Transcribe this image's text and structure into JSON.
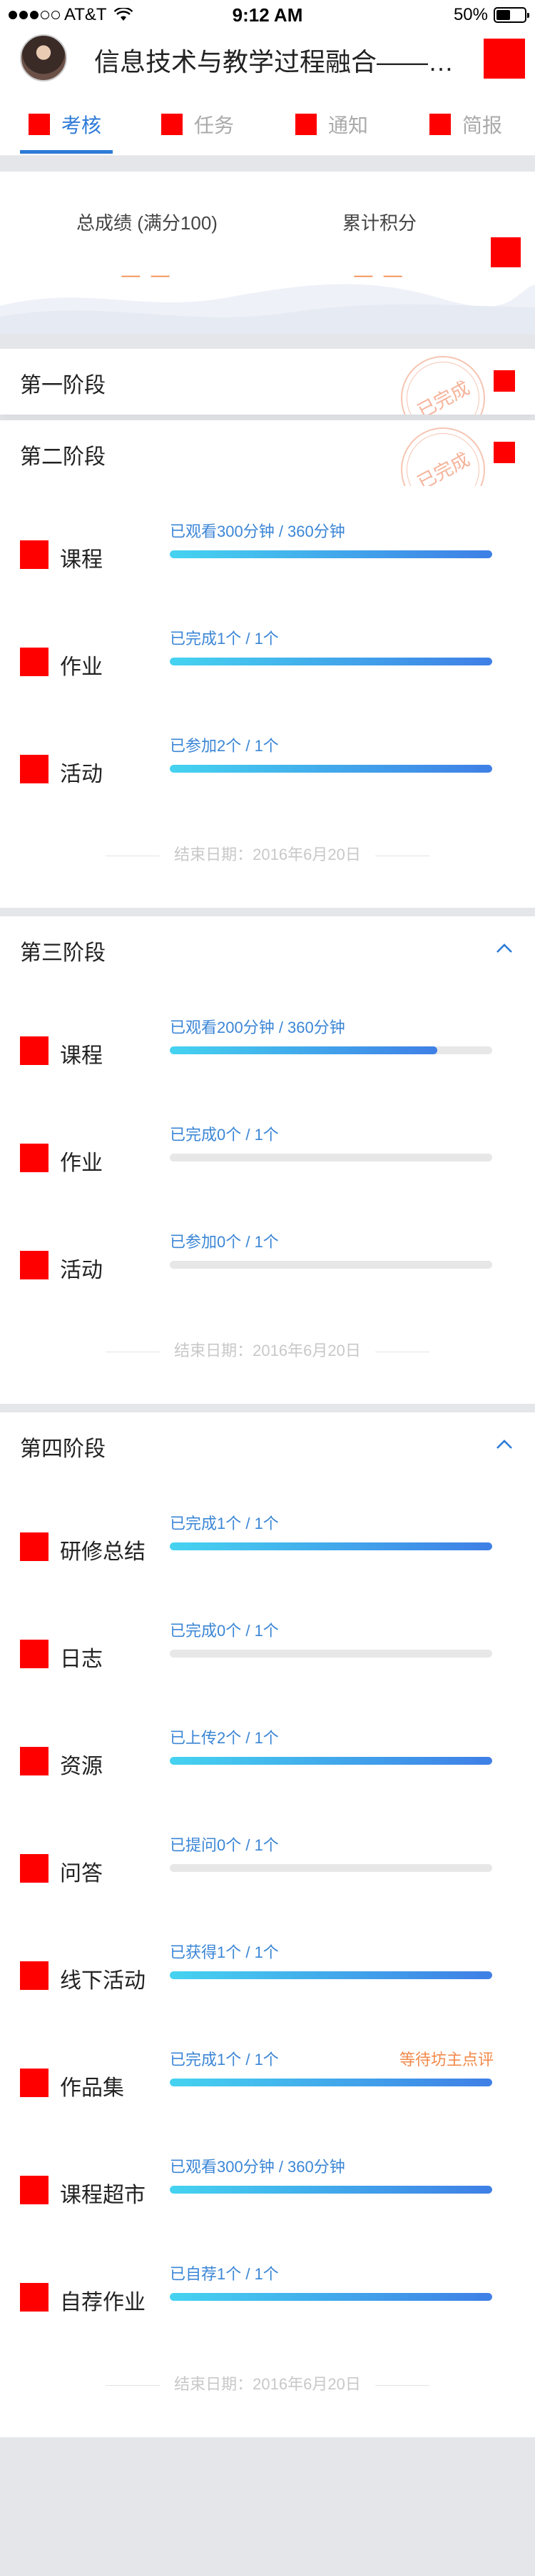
{
  "status_bar": {
    "carrier": "AT&T",
    "time": "9:12 AM",
    "battery": "50%"
  },
  "header": {
    "title": "信息技术与教学过程融合——教..."
  },
  "tabs": [
    {
      "label": "考核",
      "active": true
    },
    {
      "label": "任务",
      "active": false
    },
    {
      "label": "通知",
      "active": false
    },
    {
      "label": "简报",
      "active": false
    }
  ],
  "summary": {
    "total_score_label": "总成绩 (满分100)",
    "total_score_value": "— —",
    "points_label": "累计积分",
    "points_value": "— —"
  },
  "stages": [
    {
      "title": "第一阶段",
      "stamp": "已完成",
      "expanded": false
    },
    {
      "title": "第二阶段",
      "stamp": "已完成",
      "expanded": true,
      "items": [
        {
          "name": "课程",
          "progress": "已观看300分钟 / 360分钟",
          "fill": 1.0
        },
        {
          "name": "作业",
          "progress": "已完成1个 / 1个",
          "fill": 1.0
        },
        {
          "name": "活动",
          "progress": "已参加2个 / 1个",
          "fill": 1.0
        }
      ],
      "end_date": "结束日期：2016年6月20日"
    },
    {
      "title": "第三阶段",
      "expanded": true,
      "items": [
        {
          "name": "课程",
          "progress": "已观看200分钟 / 360分钟",
          "fill": 0.83
        },
        {
          "name": "作业",
          "progress": "已完成0个 / 1个",
          "fill": 0.0
        },
        {
          "name": "活动",
          "progress": "已参加0个 / 1个",
          "fill": 0.0
        }
      ],
      "end_date": "结束日期：2016年6月20日"
    },
    {
      "title": "第四阶段",
      "expanded": true,
      "items": [
        {
          "name": "研修总结",
          "progress": "已完成1个 / 1个",
          "fill": 1.0
        },
        {
          "name": "日志",
          "progress": "已完成0个 / 1个",
          "fill": 0.0
        },
        {
          "name": "资源",
          "progress": "已上传2个 / 1个",
          "fill": 1.0
        },
        {
          "name": "问答",
          "progress": "已提问0个 / 1个",
          "fill": 0.0
        },
        {
          "name": "线下活动",
          "progress": "已获得1个 / 1个",
          "fill": 1.0
        },
        {
          "name": "作品集",
          "progress": "已完成1个 / 1个",
          "fill": 1.0,
          "note": "等待坊主点评"
        },
        {
          "name": "课程超市",
          "progress": "已观看300分钟 / 360分钟",
          "fill": 1.0
        },
        {
          "name": "自荐作业",
          "progress": "已自荐1个 / 1个",
          "fill": 1.0
        }
      ],
      "end_date": "结束日期：2016年6月20日"
    }
  ],
  "colors": {
    "accent": "#2d7bd8",
    "warning": "#f28a4b",
    "bar_start": "#45d3f0",
    "bar_end": "#3f7fe6"
  }
}
